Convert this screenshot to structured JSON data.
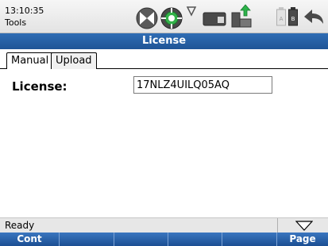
{
  "header": {
    "time": "13:10:35",
    "breadcrumb": "Tools"
  },
  "status_icons": [
    "satellite-dish-icon",
    "gps-target-icon",
    "signal-drop-icon",
    "sd-card-icon",
    "usb-transfer-icon",
    "battery-a-icon",
    "battery-b-icon",
    "back-arrow-icon"
  ],
  "title": "License",
  "tabs": [
    {
      "label": "Manual",
      "selected": true
    },
    {
      "label": "Upload",
      "selected": false
    }
  ],
  "form": {
    "license_label": "License:",
    "license_value": "17NLZ4UILQ05AQ"
  },
  "statusbar": {
    "text": "Ready"
  },
  "softkeys": [
    "Cont",
    "",
    "",
    "",
    "",
    "Page"
  ],
  "colors": {
    "title_blue": "#1f5496",
    "gps_green": "#2ea043",
    "usb_green": "#2cb34a"
  }
}
